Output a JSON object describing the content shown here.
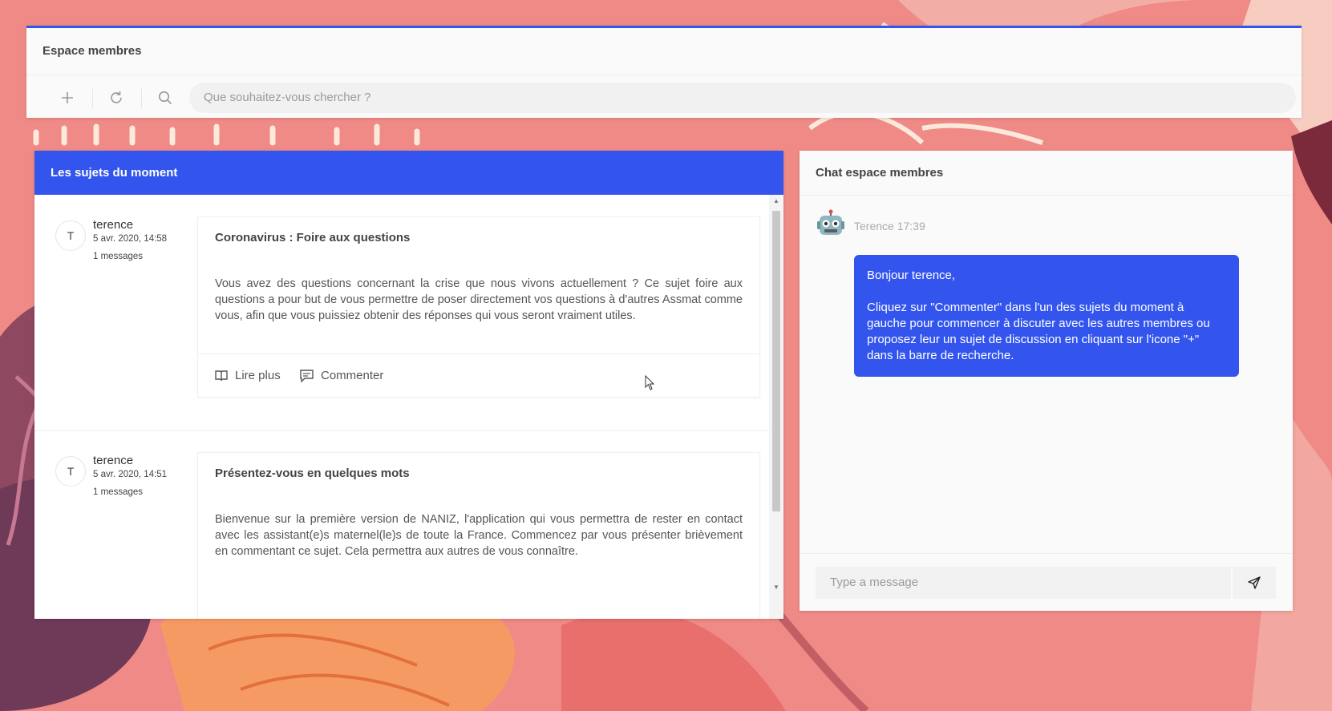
{
  "colors": {
    "accent": "#3355ee",
    "background": "#ef8a86"
  },
  "header": {
    "title": "Espace membres",
    "toolbar": {
      "add_icon": "plus-icon",
      "refresh_icon": "refresh-icon",
      "search_icon": "search-icon"
    },
    "search": {
      "placeholder": "Que souhaitez-vous chercher ?"
    }
  },
  "topics": {
    "title": "Les sujets du moment",
    "posts": [
      {
        "initial": "T",
        "author": "terence",
        "date": "5 avr. 2020, 14:58",
        "count": "1 messages",
        "title": "Coronavirus : Foire aux questions",
        "body": "Vous avez des questions concernant la crise que nous vivons actuellement ? Ce sujet foire aux questions a pour but de vous permettre de poser directement vos questions à d'autres Assmat comme vous, afin que vous puissiez obtenir des réponses qui vous seront vraiment utiles.",
        "read_more": "Lire plus",
        "comment": "Commenter"
      },
      {
        "initial": "T",
        "author": "terence",
        "date": "5 avr. 2020, 14:51",
        "count": "1 messages",
        "title": "Présentez-vous en quelques mots",
        "body": "Bienvenue sur la première version de NANIZ, l'application qui vous permettra de rester en contact avec les assistant(e)s maternel(le)s de toute la France. Commencez par vous présenter brièvement en commentant ce sujet. Cela permettra aux autres de vous connaître."
      }
    ]
  },
  "chat": {
    "title": "Chat espace membres",
    "message": {
      "avatar_icon": "robot-icon",
      "meta": "Terence 17:39",
      "greeting": "Bonjour terence,",
      "text": "Cliquez sur \"Commenter\" dans l'un des sujets du moment à gauche pour commencer à discuter avec les autres membres ou proposez leur un sujet de discussion en cliquant sur l'icone \"+\" dans la barre de recherche."
    },
    "input": {
      "placeholder": "Type a message"
    },
    "send_icon": "send-icon"
  }
}
